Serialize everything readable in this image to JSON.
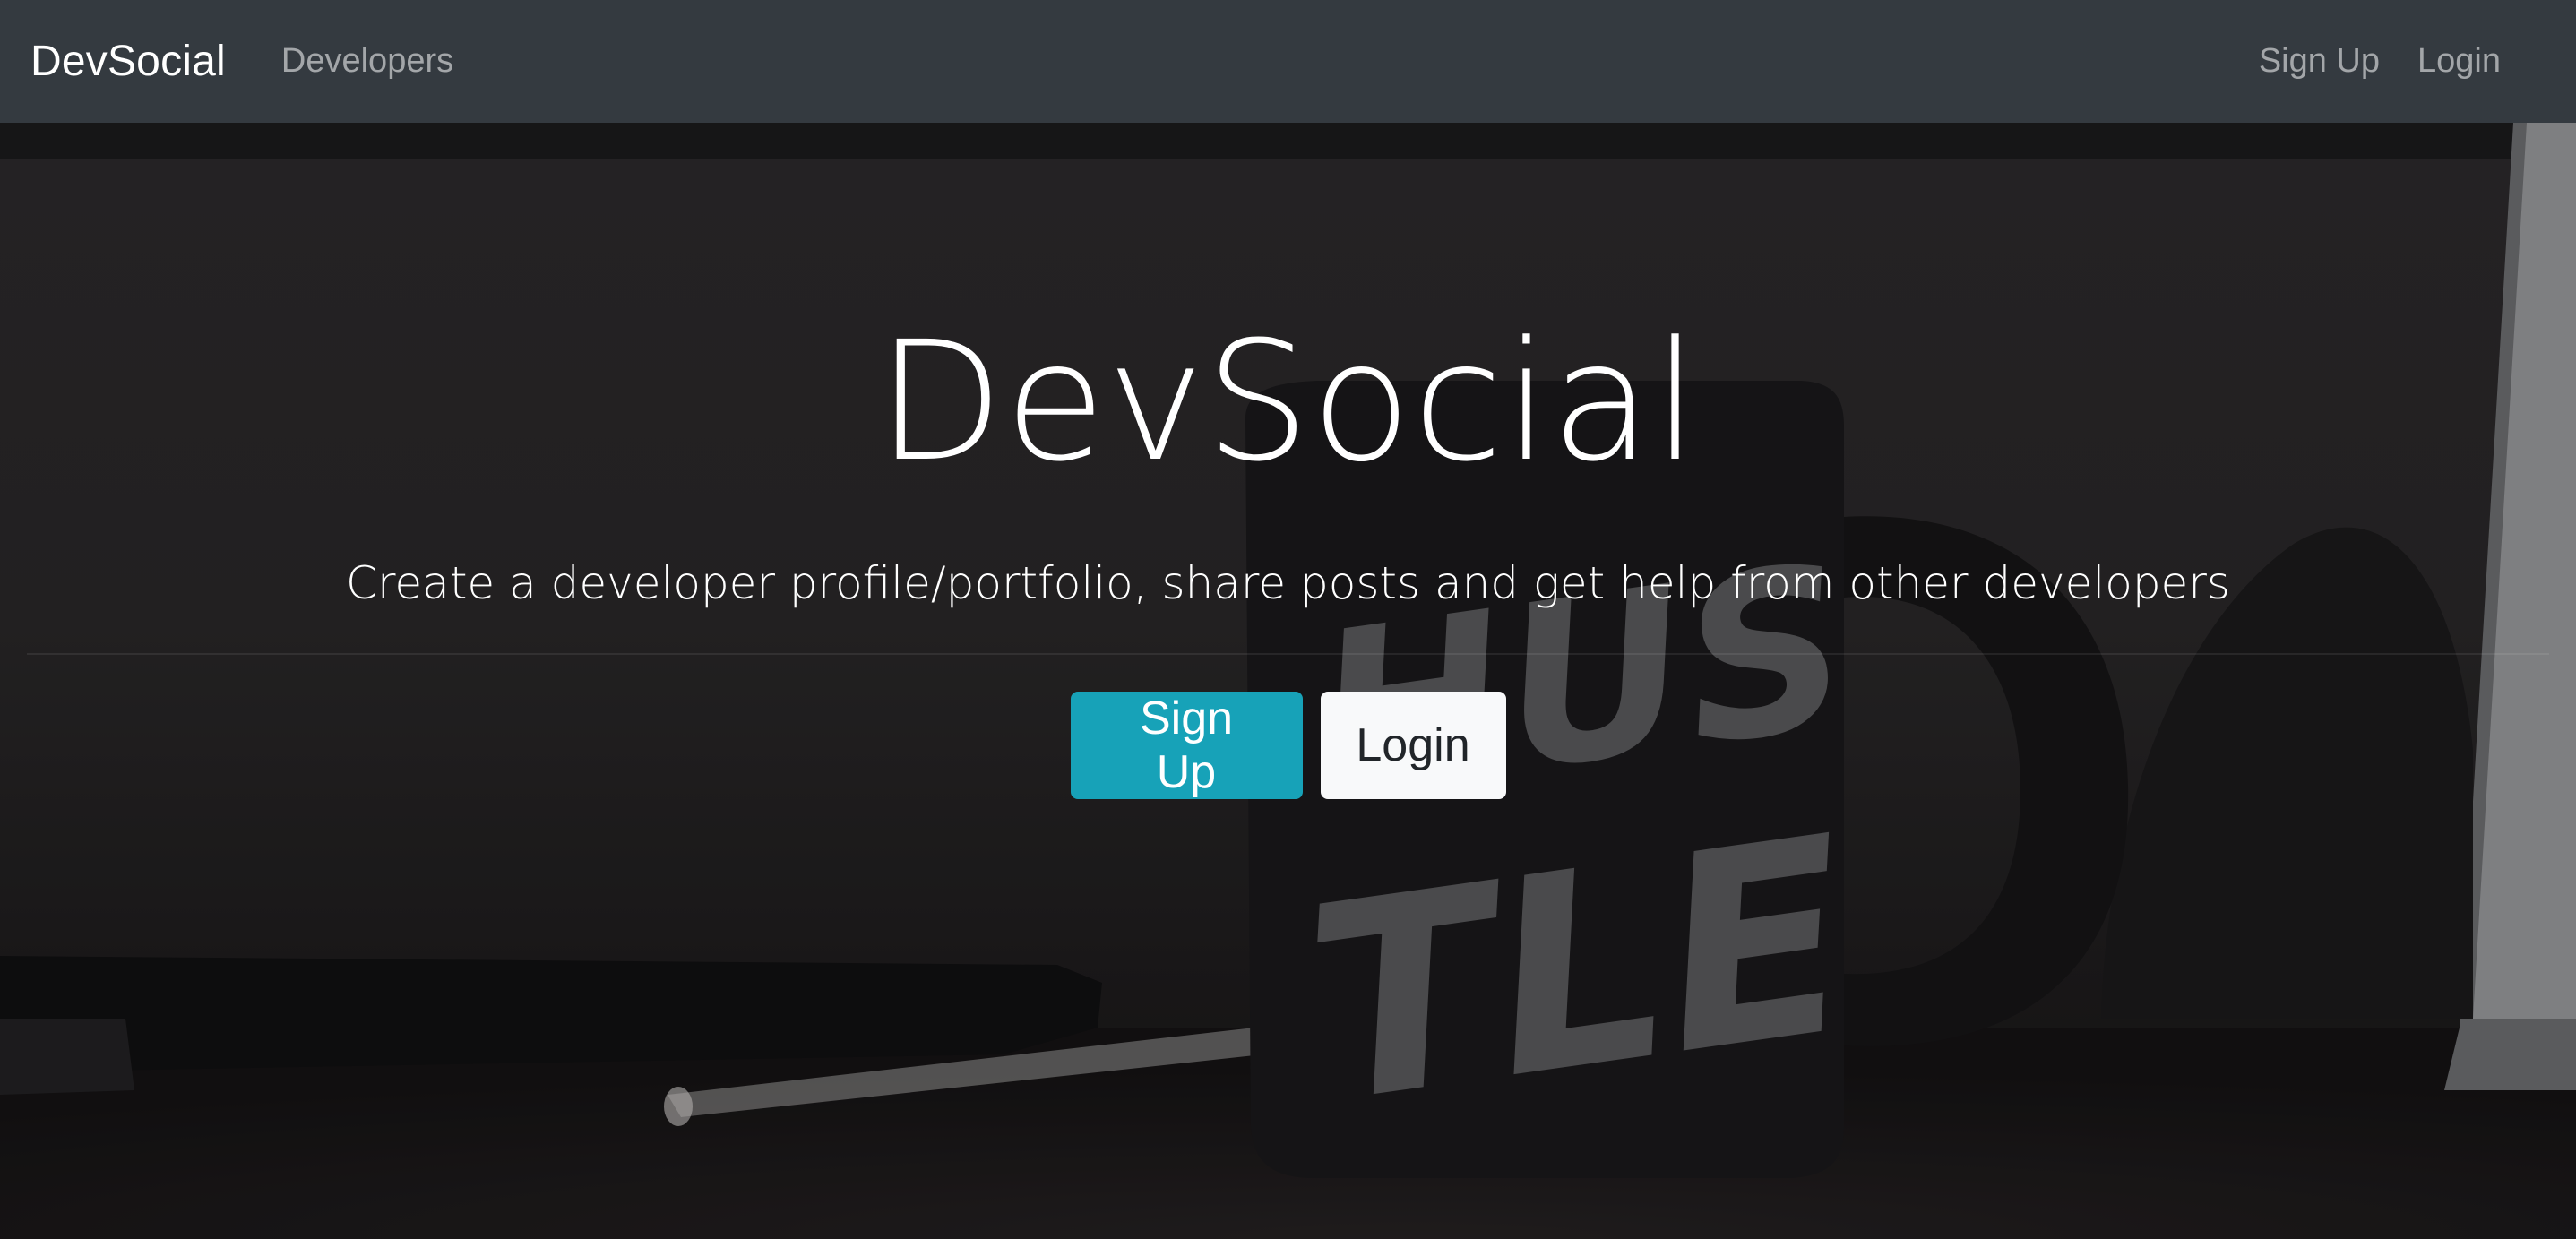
{
  "navbar": {
    "brand": "DevSocial",
    "links": [
      {
        "label": "Developers"
      }
    ],
    "right_links": [
      {
        "label": "Sign Up"
      },
      {
        "label": "Login"
      }
    ]
  },
  "hero": {
    "title": "DevSocial",
    "lead": "Create a developer profile/portfolio, share posts and get help from other developers",
    "background_text": "HUSTLE",
    "buttons": [
      {
        "label": "Sign Up",
        "color": "#17a2b8"
      },
      {
        "label": "Login",
        "color": "#f8f9fa"
      }
    ]
  },
  "colors": {
    "navbar_bg": "#343a40",
    "accent": "#17a2b8"
  }
}
